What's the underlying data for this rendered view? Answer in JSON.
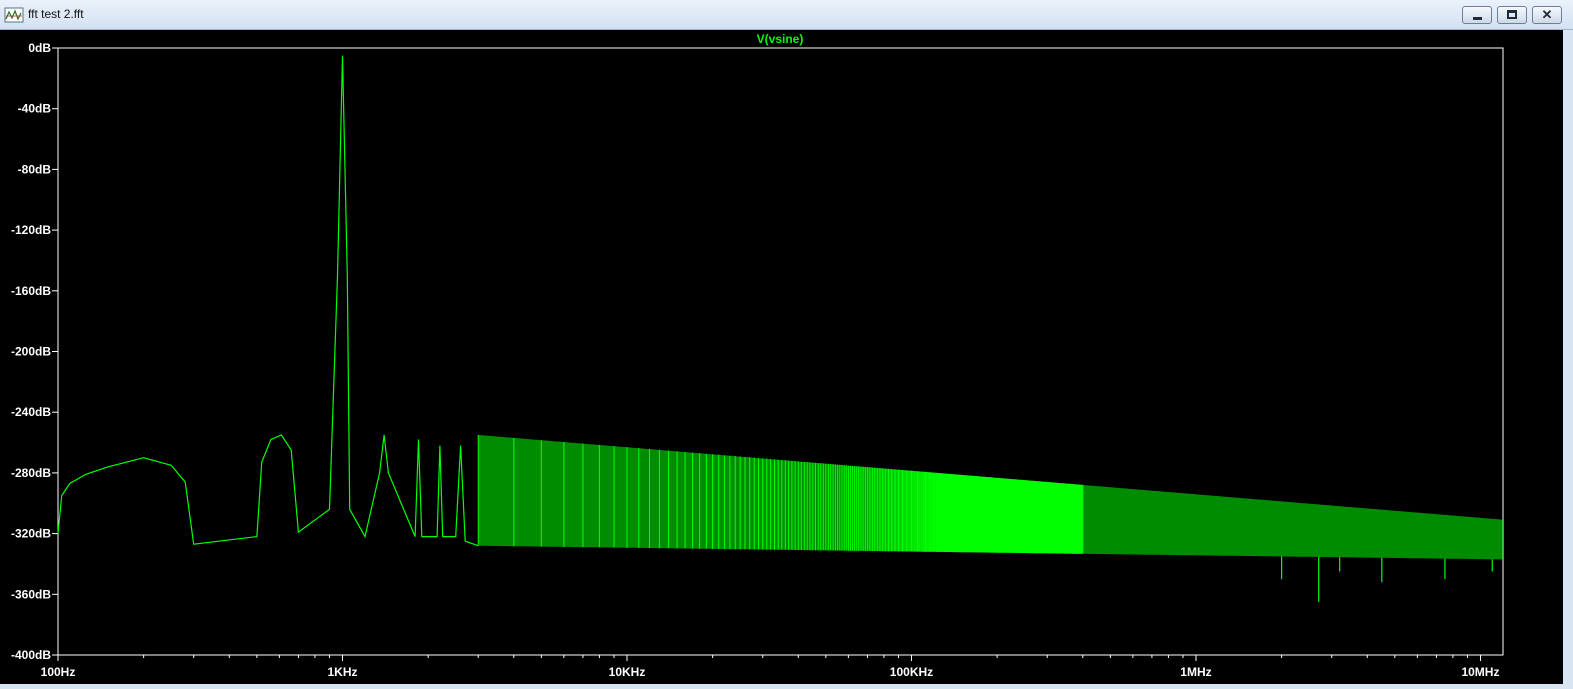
{
  "window": {
    "title": "fft test 2.fft",
    "minimize_icon": "minimize-icon",
    "maximize_icon": "maximize-icon",
    "close_icon": "close-icon",
    "app_icon": "waveform-icon"
  },
  "colors": {
    "plot_background": "#000000",
    "trace": "#00ff00",
    "axis": "#ffffff",
    "frame": "#d7e4f2"
  },
  "chart_data": {
    "type": "line",
    "title": "V(vsine)",
    "xscale": "log",
    "xlim": [
      100,
      12000000
    ],
    "ylim": [
      -400,
      0
    ],
    "grid": false,
    "yticks": [
      0,
      -40,
      -80,
      -120,
      -160,
      -200,
      -240,
      -280,
      -320,
      -360,
      -400
    ],
    "ytick_labels": [
      "0dB",
      "-40dB",
      "-80dB",
      "-120dB",
      "-160dB",
      "-200dB",
      "-240dB",
      "-280dB",
      "-320dB",
      "-360dB",
      "-400dB"
    ],
    "xticks": [
      100,
      1000,
      10000,
      100000,
      1000000,
      10000000
    ],
    "xtick_labels": [
      "100Hz",
      "1KHz",
      "10KHz",
      "100KHz",
      "1MHz",
      "10MHz"
    ],
    "series": [
      {
        "name": "V(vsine)",
        "x": [
          100,
          103,
          110,
          125,
          150,
          200,
          250,
          280,
          300,
          500,
          520,
          560,
          610,
          660,
          700,
          900,
          960,
          1000,
          1040,
          1060,
          1200,
          1350,
          1400,
          1450,
          1800,
          1850,
          1900,
          2150,
          2200,
          2250,
          2500,
          2600,
          2700,
          3000
        ],
        "y": [
          -320,
          -295,
          -287,
          -281,
          -276,
          -270,
          -275,
          -286,
          -327,
          -322,
          -273,
          -258,
          -255,
          -265,
          -319,
          -304,
          -150,
          -5,
          -150,
          -304,
          -322,
          -280,
          -255,
          -280,
          -322,
          -258,
          -322,
          -322,
          -262,
          -322,
          -322,
          -262,
          -325,
          -328
        ]
      }
    ]
  }
}
